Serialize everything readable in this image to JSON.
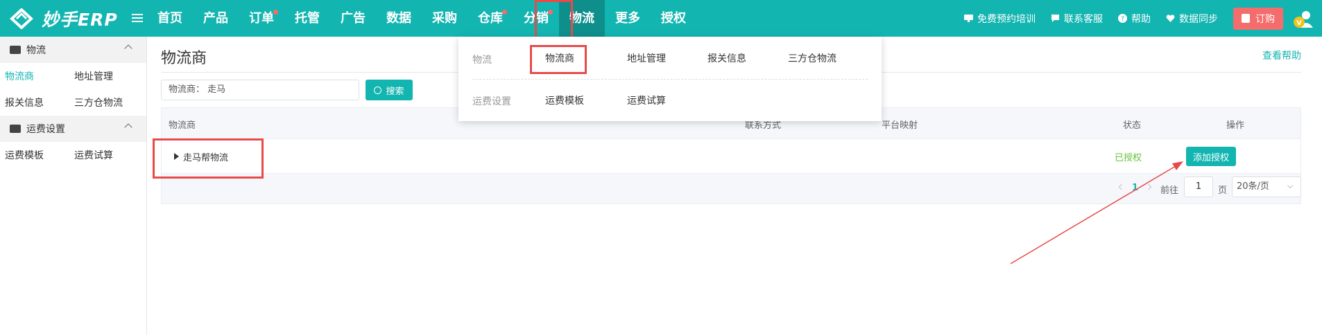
{
  "app": {
    "logo_text": "妙手ERP"
  },
  "nav": {
    "items": [
      {
        "label": "首页",
        "dot": false
      },
      {
        "label": "产品",
        "dot": false
      },
      {
        "label": "订单",
        "dot": true
      },
      {
        "label": "托管",
        "dot": false
      },
      {
        "label": "广告",
        "dot": false
      },
      {
        "label": "数据",
        "dot": false
      },
      {
        "label": "采购",
        "dot": false
      },
      {
        "label": "仓库",
        "dot": true
      },
      {
        "label": "分销",
        "dot": true
      },
      {
        "label": "物流",
        "dot": false,
        "active": true
      },
      {
        "label": "更多",
        "dot": false
      },
      {
        "label": "授权",
        "dot": false
      }
    ]
  },
  "tools": {
    "training": "免费预约培训",
    "support": "联系客服",
    "help": "帮助",
    "sync": "数据同步",
    "order": "订购"
  },
  "sidebar": {
    "group1": {
      "label": "物流"
    },
    "group1_items": [
      "物流商",
      "地址管理",
      "报关信息",
      "三方仓物流"
    ],
    "group2": {
      "label": "运费设置"
    },
    "group2_items": [
      "运费模板",
      "运费试算"
    ]
  },
  "main": {
    "title": "物流商",
    "help_link": "查看帮助",
    "search_value": "物流商：   走马",
    "search_button": "搜索",
    "columns": {
      "provider": "物流商",
      "contact": "联系方式",
      "platform": "平台映射",
      "status": "状态",
      "actions": "操作"
    },
    "rows": [
      {
        "name": "走马帮物流",
        "status": "已授权",
        "action": "添加授权"
      }
    ],
    "pager": {
      "current": "1",
      "goto_label": "前往",
      "goto_value": "1",
      "page_label": "页",
      "page_size": "20条/页"
    }
  },
  "dropdown": {
    "section1": {
      "label": "物流",
      "items": [
        "物流商",
        "地址管理",
        "报关信息",
        "三方仓物流"
      ]
    },
    "section2": {
      "label": "运费设置",
      "items": [
        "运费模板",
        "运费试算"
      ]
    }
  },
  "colors": {
    "primary": "#13b5b1",
    "annotation": "#e84a4a",
    "authorized": "#67c23a"
  }
}
